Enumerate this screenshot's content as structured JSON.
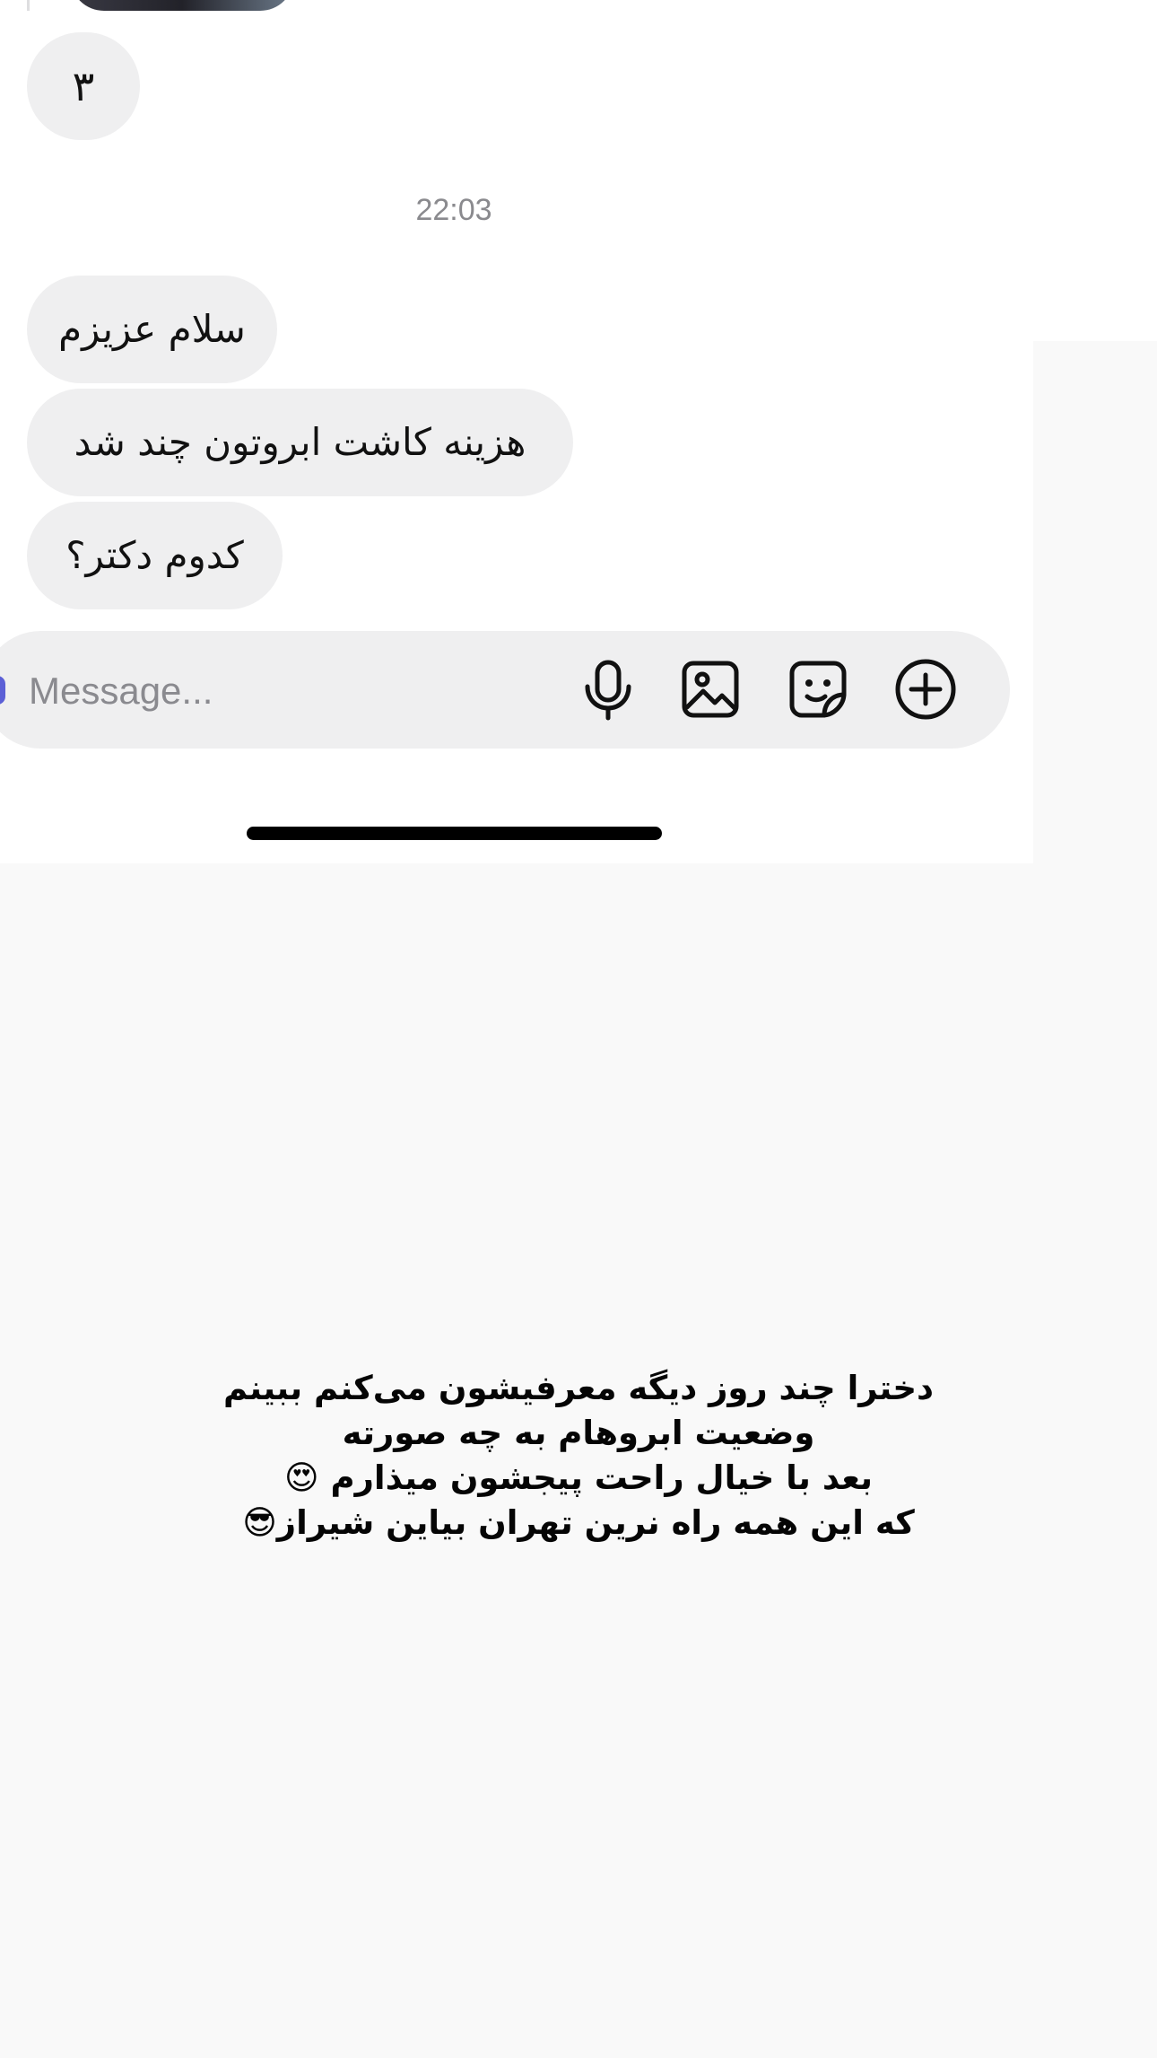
{
  "colors": {
    "bubble": "#efeff0",
    "background": "#f9f9f9",
    "accent": "#5b5fd6",
    "text": "#111111",
    "muted": "#8a8a8e"
  },
  "chat": {
    "number_message": "٣",
    "timestamp": "22:03",
    "messages": [
      "سلام عزیزم",
      "هزینه کاشت ابروتون چند شد",
      "کدوم دکتر؟"
    ]
  },
  "composer": {
    "placeholder": "Message...",
    "icons": [
      "microphone-icon",
      "image-icon",
      "sticker-icon",
      "plus-icon"
    ]
  },
  "caption": {
    "lines": [
      "دخترا چند روز دیگه معرفیشون می‌کنم ببینم",
      "وضعیت ابروهام به چه صورته",
      "بعد با خیال راحت پیجشون میذارم 😍",
      "که این همه راه نرین تهران بیاین شیراز😎"
    ]
  }
}
